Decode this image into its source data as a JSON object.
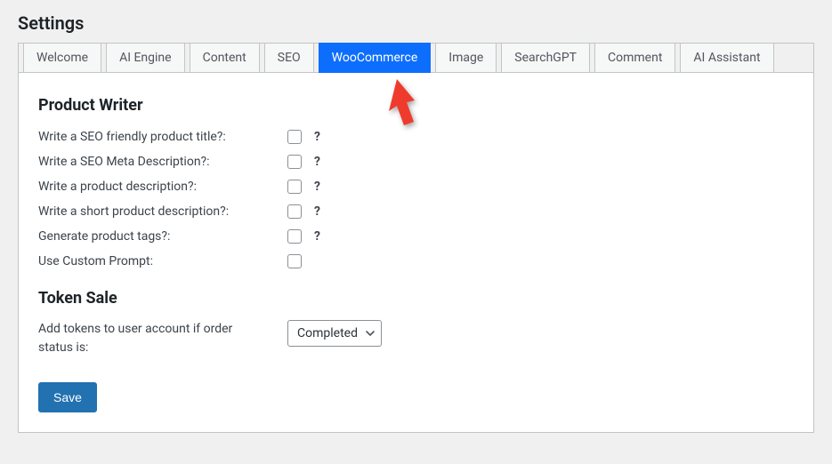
{
  "page_title": "Settings",
  "tabs": [
    "Welcome",
    "AI Engine",
    "Content",
    "SEO",
    "WooCommerce",
    "Image",
    "SearchGPT",
    "Comment",
    "AI Assistant"
  ],
  "active_tab_index": 4,
  "sections": {
    "product_writer": {
      "title": "Product Writer",
      "options": [
        {
          "label": "Write a SEO friendly product title?:",
          "help": "?"
        },
        {
          "label": "Write a SEO Meta Description?:",
          "help": "?"
        },
        {
          "label": "Write a product description?:",
          "help": "?"
        },
        {
          "label": "Write a short product description?:",
          "help": "?"
        },
        {
          "label": "Generate product tags?:",
          "help": "?"
        },
        {
          "label": "Use Custom Prompt:",
          "help": ""
        }
      ]
    },
    "token_sale": {
      "title": "Token Sale",
      "label": "Add tokens to user account if order status is:",
      "select_value": "Completed"
    }
  },
  "save_label": "Save"
}
